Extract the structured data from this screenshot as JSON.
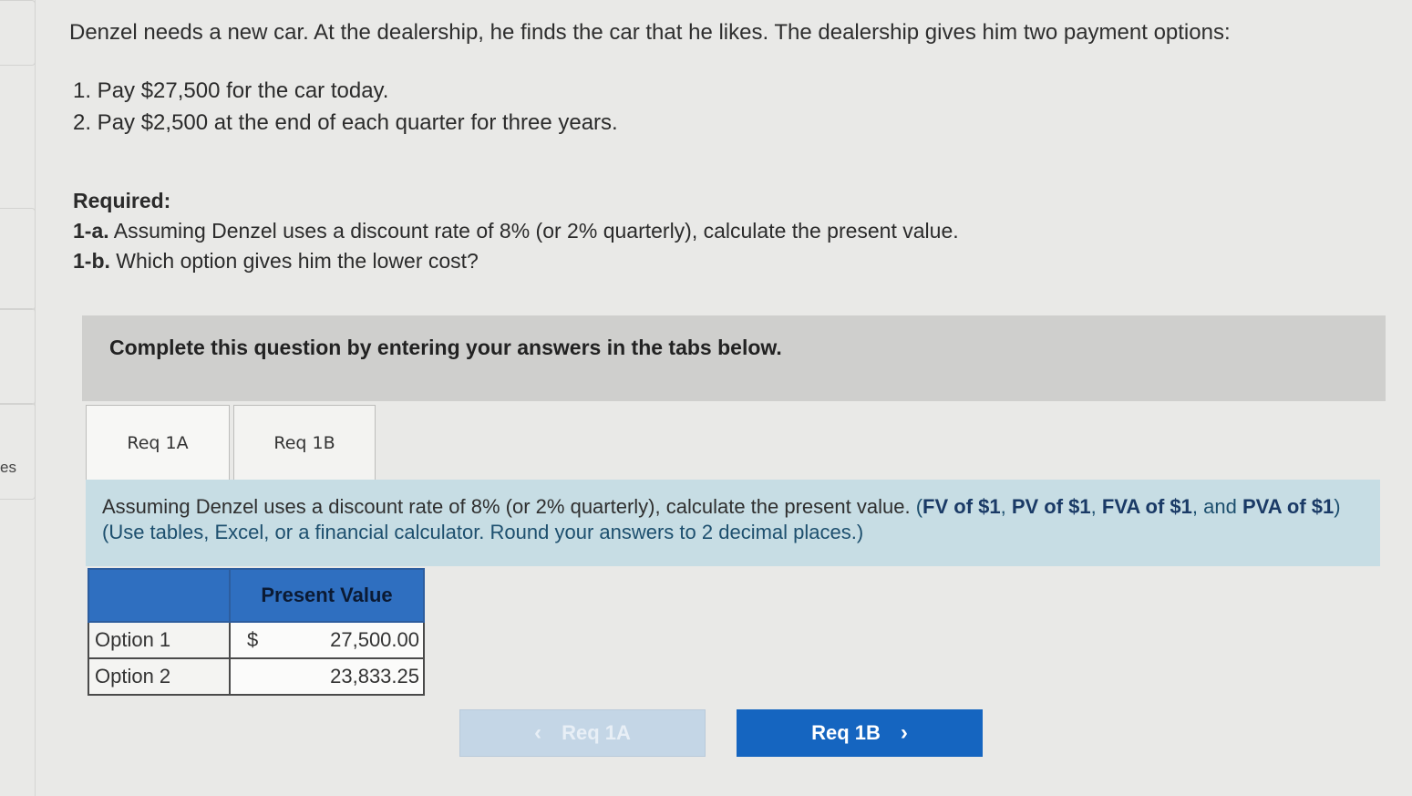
{
  "sidebar": {
    "partial_label": "es"
  },
  "question": {
    "intro": "Denzel needs a new car. At the dealership, he finds the car that he likes. The dealership gives him two payment options:",
    "options": [
      "1. Pay $27,500 for the car today.",
      "2. Pay $2,500 at the end of each quarter for three years."
    ],
    "required_heading": "Required:",
    "req_1a_code": "1-a.",
    "req_1a_text": "Assuming Denzel uses a discount rate of 8% (or 2% quarterly), calculate the present value.",
    "req_1b_code": "1-b.",
    "req_1b_text": "Which option gives him the lower cost?"
  },
  "banner": {
    "text": "Complete this question by entering your answers in the tabs below."
  },
  "tabs": [
    {
      "label": "Req 1A",
      "active": true
    },
    {
      "label": "Req 1B",
      "active": false
    }
  ],
  "panel": {
    "instruction": "Assuming Denzel uses a discount rate of 8% (or 2% quarterly), calculate the present value.",
    "hint_open": "(",
    "hint_fv": "FV of $1",
    "hint_pv": "PV of $1",
    "hint_fva": "FVA of $1",
    "hint_and": "and",
    "hint_pva": "PVA of $1",
    "hint_close": ")",
    "hint_use": "(Use tables, Excel, or a financial calculator. Round your answers to 2 decimal places.)"
  },
  "table": {
    "header": "Present Value",
    "currency": "$",
    "rows": [
      {
        "label": "Option 1",
        "value": "27,500.00"
      },
      {
        "label": "Option 2",
        "value": "23,833.25"
      }
    ]
  },
  "nav": {
    "prev_label": "Req 1A",
    "next_label": "Req 1B"
  },
  "colors": {
    "banner": "#cfcfcd",
    "panel": "#c7dde4",
    "table_header": "#2f6fc0",
    "next_button": "#1565c0",
    "prev_button": "#c4d6e6"
  }
}
